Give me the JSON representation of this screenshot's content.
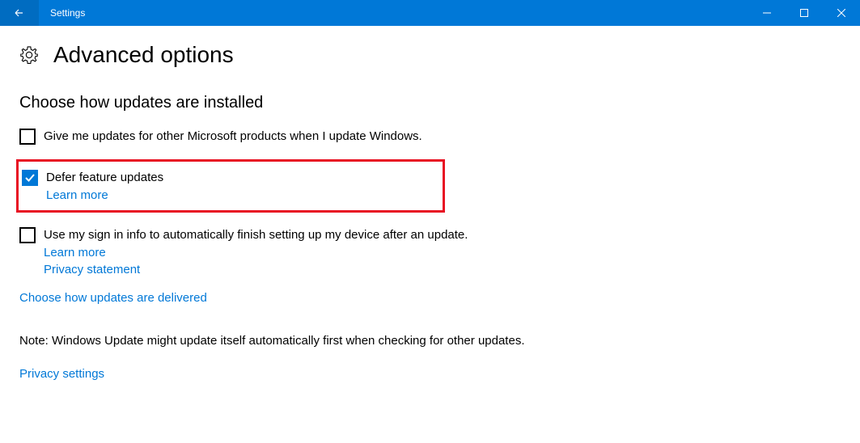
{
  "titlebar": {
    "title": "Settings"
  },
  "header": {
    "title": "Advanced options"
  },
  "section": {
    "title": "Choose how updates are installed"
  },
  "options": {
    "microsoft_products": {
      "label": "Give me updates for other Microsoft products when I update Windows.",
      "checked": false
    },
    "defer_updates": {
      "label": "Defer feature updates",
      "checked": true,
      "learn_more": "Learn more"
    },
    "signin_info": {
      "label": "Use my sign in info to automatically finish setting up my device after an update.",
      "checked": false,
      "learn_more": "Learn more"
    }
  },
  "links": {
    "privacy_statement": "Privacy statement",
    "delivery": "Choose how updates are delivered",
    "privacy_settings": "Privacy settings"
  },
  "note": "Note: Windows Update might update itself automatically first when checking for other updates."
}
